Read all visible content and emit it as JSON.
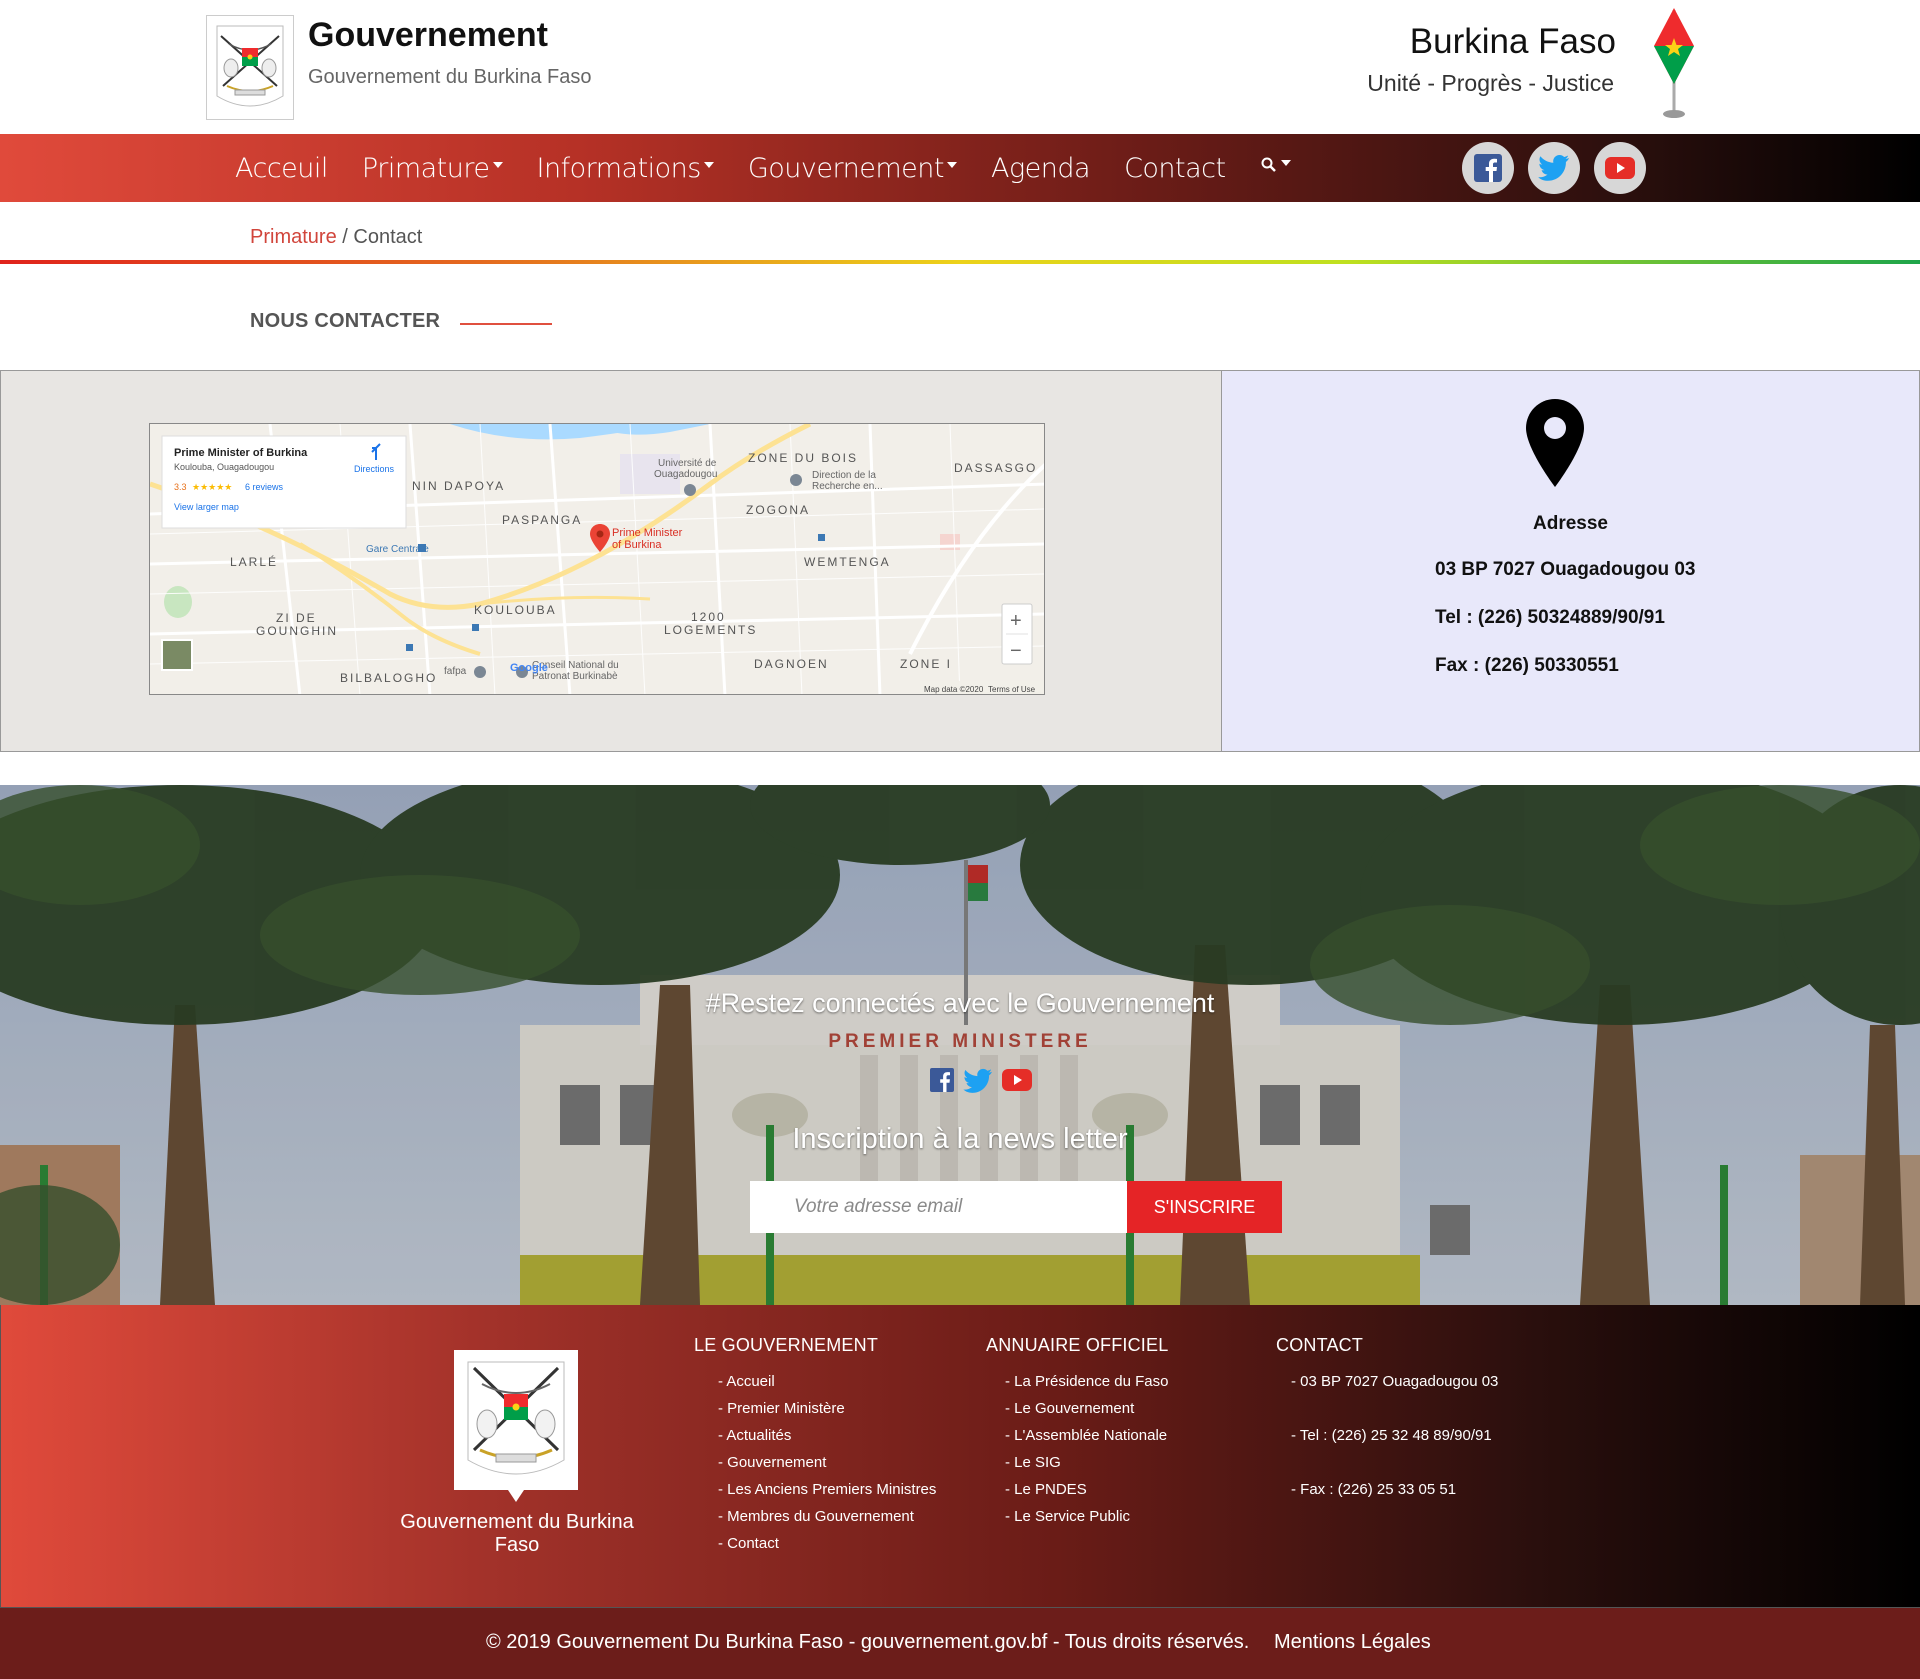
{
  "header": {
    "brand_title": "Gouvernement",
    "brand_subtitle": "Gouvernement du Burkina Faso",
    "country": "Burkina Faso",
    "motto": "Unité - Progrès - Justice"
  },
  "nav": {
    "items": [
      {
        "label": "Acceuil",
        "dropdown": false
      },
      {
        "label": "Primature",
        "dropdown": true
      },
      {
        "label": "Informations",
        "dropdown": true
      },
      {
        "label": "Gouvernement",
        "dropdown": true
      },
      {
        "label": "Agenda",
        "dropdown": false
      },
      {
        "label": "Contact",
        "dropdown": false
      }
    ],
    "social_icons": [
      "facebook-icon",
      "twitter-icon",
      "youtube-icon"
    ]
  },
  "breadcrumb": {
    "parent": "Primature",
    "separator": " / ",
    "current": "Contact"
  },
  "section": {
    "title": "NOUS CONTACTER"
  },
  "map": {
    "card_title": "Prime Minister of Burkina",
    "card_subtitle": "Koulouba, Ouagadougou",
    "rating": "3.3",
    "reviews": "6 reviews",
    "larger_map": "View larger map",
    "directions": "Directions",
    "marker_label_1": "Prime Minister",
    "marker_label_2": "of Burkina",
    "zoom_in": "+",
    "zoom_out": "−",
    "attribution": "Map data ©2020",
    "terms": "Terms of Use",
    "google": "Google",
    "places": {
      "dapoya": "NIN DAPOYA",
      "paspanga": "PASPANGA",
      "zone_du_bois": "ZONE DU BOIS",
      "dassasgo": "DASSASGO",
      "zogona": "ZOGONA",
      "wemtenga": "WEMTENGA",
      "larle": "LARLÉ",
      "zi_de": "ZI DE",
      "gounghin": "GOUNGHIN",
      "koulouba": "KOULOUBA",
      "logements_1": "1200",
      "logements_2": "LOGEMENTS",
      "dagnoen": "DAGNOEN",
      "zone_i": "ZONE I",
      "bilbalogho": "BILBALOGHO",
      "universite_1": "Université de",
      "universite_2": "Ouagadougou",
      "direction_1": "Direction de la",
      "direction_2": "Recherche en...",
      "gare": "Gare Centrale",
      "fafpa": "fafpa",
      "conseil_1": "Conseil National du",
      "conseil_2": "Patronat Burkinabè"
    }
  },
  "address": {
    "label": "Adresse",
    "postal": "03 BP 7027 Ouagadougou 03",
    "tel": "Tel : (226) 50324889/90/91",
    "fax": "Fax : (226) 50330551"
  },
  "hero": {
    "title": "#Restez connectés avec le Gouvernement",
    "subtitle": "Inscription à la news letter",
    "email_placeholder": "Votre adresse email",
    "subscribe_label": "S'INSCRIRE",
    "building_sign": "PREMIER MINISTERE"
  },
  "footer": {
    "brand": "Gouvernement du Burkina Faso",
    "col_gouvernement": {
      "title": "LE GOUVERNEMENT",
      "links": [
        "- Accueil",
        "- Premier Ministère",
        "- Actualités",
        "- Gouvernement",
        "- Les Anciens Premiers Ministres",
        "- Membres du Gouvernement",
        "- Contact"
      ]
    },
    "col_annuaire": {
      "title": "ANNUAIRE OFFICIEL",
      "links": [
        "- La Présidence du Faso",
        "- Le Gouvernement",
        "- L'Assemblée Nationale",
        "- Le SIG",
        "- Le PNDES",
        "- Le Service Public"
      ]
    },
    "col_contact": {
      "title": "CONTACT",
      "lines": [
        "- 03 BP 7027 Ouagadougou 03",
        "- Tel : (226) 25 32 48 89/90/91",
        "- Fax : (226) 25 33 05 51"
      ]
    },
    "copyright": "© 2019 Gouvernement Du Burkina Faso - gouvernement.gov.bf - Tous droits réservés.",
    "mentions": "Mentions Légales"
  },
  "colors": {
    "accent_red": "#e52426",
    "link_red": "#d1453b",
    "flag_red": "#ef2b2d",
    "flag_green": "#009e49",
    "flag_star": "#fcd116"
  }
}
